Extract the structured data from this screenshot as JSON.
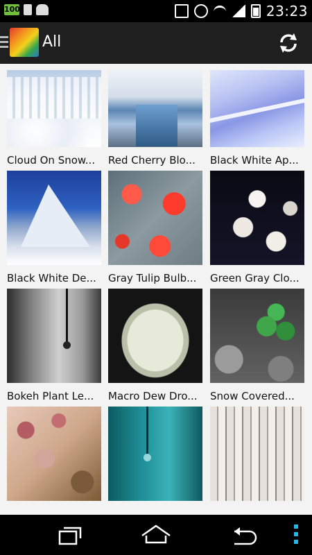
{
  "status_bar": {
    "time": "23:23",
    "battery_small": "100"
  },
  "action_bar": {
    "title": "All"
  },
  "wallpapers": [
    {
      "caption": "Cloud On Snow..."
    },
    {
      "caption": "Red Cherry Blo..."
    },
    {
      "caption": "Black White Ap..."
    },
    {
      "caption": "Black White De..."
    },
    {
      "caption": "Gray Tulip Bulb..."
    },
    {
      "caption": "Green Gray Clo..."
    },
    {
      "caption": "Bokeh Plant Le..."
    },
    {
      "caption": "Macro Dew Dro..."
    },
    {
      "caption": "Snow Covered..."
    },
    {
      "caption": ""
    },
    {
      "caption": ""
    },
    {
      "caption": ""
    }
  ],
  "icons": {
    "menu": "menu-icon",
    "refresh": "refresh-icon",
    "recent_apps": "recent-apps-icon",
    "home": "home-icon",
    "back": "back-icon",
    "overflow": "overflow-menu-icon"
  },
  "colors": {
    "action_bar": "#1f1f1f",
    "status_bar": "#000000",
    "overflow_accent": "#2bb7e5",
    "background": "#f3f3f3"
  }
}
